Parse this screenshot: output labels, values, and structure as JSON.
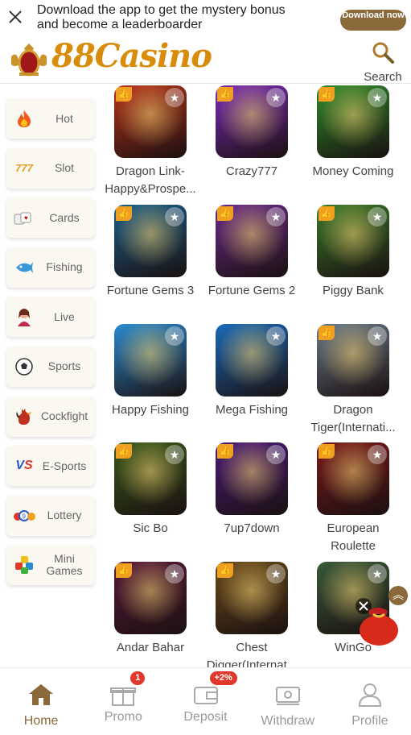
{
  "banner": {
    "text": "Download the app to get the mystery bonus and become a leaderboarder",
    "download_label": "Download now"
  },
  "header": {
    "logo_text": "88Casino",
    "search_label": "Search"
  },
  "categories": [
    {
      "label": "Hot",
      "icon": "flame-icon"
    },
    {
      "label": "Slot",
      "icon": "slot-777-icon"
    },
    {
      "label": "Cards",
      "icon": "cards-icon"
    },
    {
      "label": "Fishing",
      "icon": "fish-icon"
    },
    {
      "label": "Live",
      "icon": "live-dealer-icon"
    },
    {
      "label": "Sports",
      "icon": "soccer-ball-icon"
    },
    {
      "label": "Cockfight",
      "icon": "rooster-icon"
    },
    {
      "label": "E-Sports",
      "icon": "vs-icon"
    },
    {
      "label": "Lottery",
      "icon": "lottery-balls-icon"
    },
    {
      "label": "Mini Games",
      "icon": "cubes-icon"
    }
  ],
  "games": [
    {
      "name": "Dragon Link-Happy&Prospe...",
      "bg": "#b8321a",
      "hot": true
    },
    {
      "name": "Crazy777",
      "bg": "#7a2bb8",
      "hot": true
    },
    {
      "name": "Money Coming",
      "bg": "#2e8a2a",
      "hot": true
    },
    {
      "name": "Fortune Gems 3",
      "bg": "#1a5f8a",
      "hot": true
    },
    {
      "name": "Fortune Gems 2",
      "bg": "#6a2a8a",
      "hot": true
    },
    {
      "name": "Piggy Bank",
      "bg": "#3a7a2a",
      "hot": true
    },
    {
      "name": "Happy Fishing",
      "bg": "#2a8ad0",
      "hot": false
    },
    {
      "name": "Mega Fishing",
      "bg": "#1a6ab8",
      "hot": false
    },
    {
      "name": "Dragon Tiger(Internati...",
      "bg": "#6a7a8a",
      "hot": true
    },
    {
      "name": "Sic Bo",
      "bg": "#3a5a1a",
      "hot": true
    },
    {
      "name": "7up7down",
      "bg": "#4a1a7a",
      "hot": true
    },
    {
      "name": "European Roulette",
      "bg": "#7a1a1a",
      "hot": true
    },
    {
      "name": "Andar Bahar",
      "bg": "#5a1a3a",
      "hot": true
    },
    {
      "name": "Chest Digger(Internat...",
      "bg": "#6a4a1a",
      "hot": true
    },
    {
      "name": "WinGo",
      "bg": "#3a5a3a",
      "hot": false
    }
  ],
  "tabbar": [
    {
      "label": "Home",
      "icon": "home-icon",
      "badge": ""
    },
    {
      "label": "Promo",
      "icon": "gift-icon",
      "badge": "1"
    },
    {
      "label": "Deposit",
      "icon": "wallet-icon",
      "badge": "+2%"
    },
    {
      "label": "Withdraw",
      "icon": "withdraw-icon",
      "badge": ""
    },
    {
      "label": "Profile",
      "icon": "profile-icon",
      "badge": ""
    }
  ],
  "colors": {
    "accent": "#8a6a3b",
    "logo": "#d98b0a",
    "badge": "#e0392b"
  }
}
